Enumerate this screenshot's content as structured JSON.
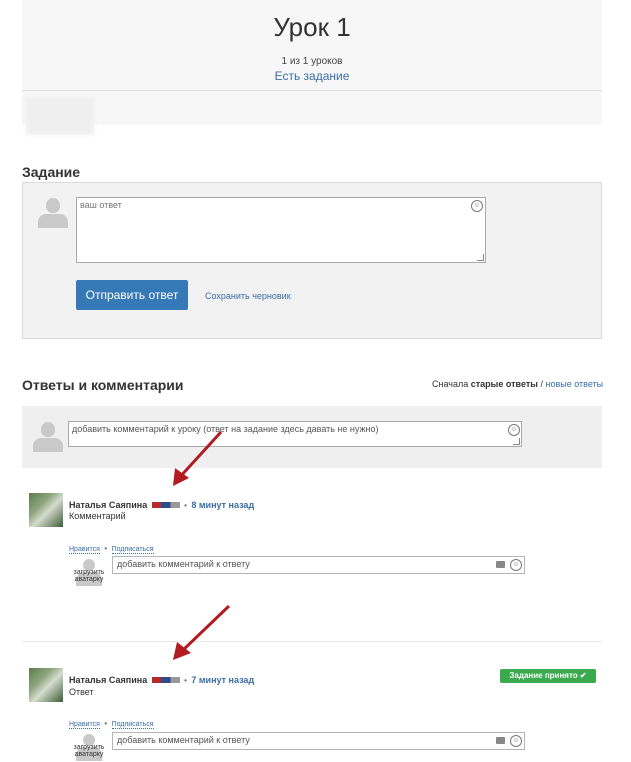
{
  "lesson": {
    "title": "Урок 1",
    "counter": "1 из 1 уроков",
    "status_link": "Есть задание"
  },
  "task": {
    "heading": "Задание",
    "answer_placeholder": "ваш ответ",
    "submit_label": "Отправить ответ",
    "draft_label": "Сохранить черновик"
  },
  "comments": {
    "heading": "Ответы и комментарии",
    "sort_prefix": "Сначала",
    "sort_old": "старые ответы",
    "sort_sep": "/",
    "sort_new": "новые ответы",
    "new_comment_placeholder": "добавить комментарий к уроку (ответ на задание здесь давать не нужно)",
    "upload_caption": "загрузить аватарку",
    "reply_placeholder": "добавить комментарий к ответу",
    "items": [
      {
        "author": "Наталья Саяпина",
        "dot": "•",
        "time": "8 минут назад",
        "text": "Комментарий",
        "like": "Нравится",
        "subscribe": "Подписаться",
        "badge": ""
      },
      {
        "author": "Наталья Саяпина",
        "dot": "•",
        "time": "7 минут назад",
        "text": "Ответ",
        "like": "Нравится",
        "subscribe": "Подписаться",
        "badge": "Задание принято ✔"
      }
    ]
  },
  "colors": {
    "accent": "#3579b6",
    "link": "#3a6ea5",
    "success": "#3aaa4e",
    "arrow": "#b01c22"
  }
}
